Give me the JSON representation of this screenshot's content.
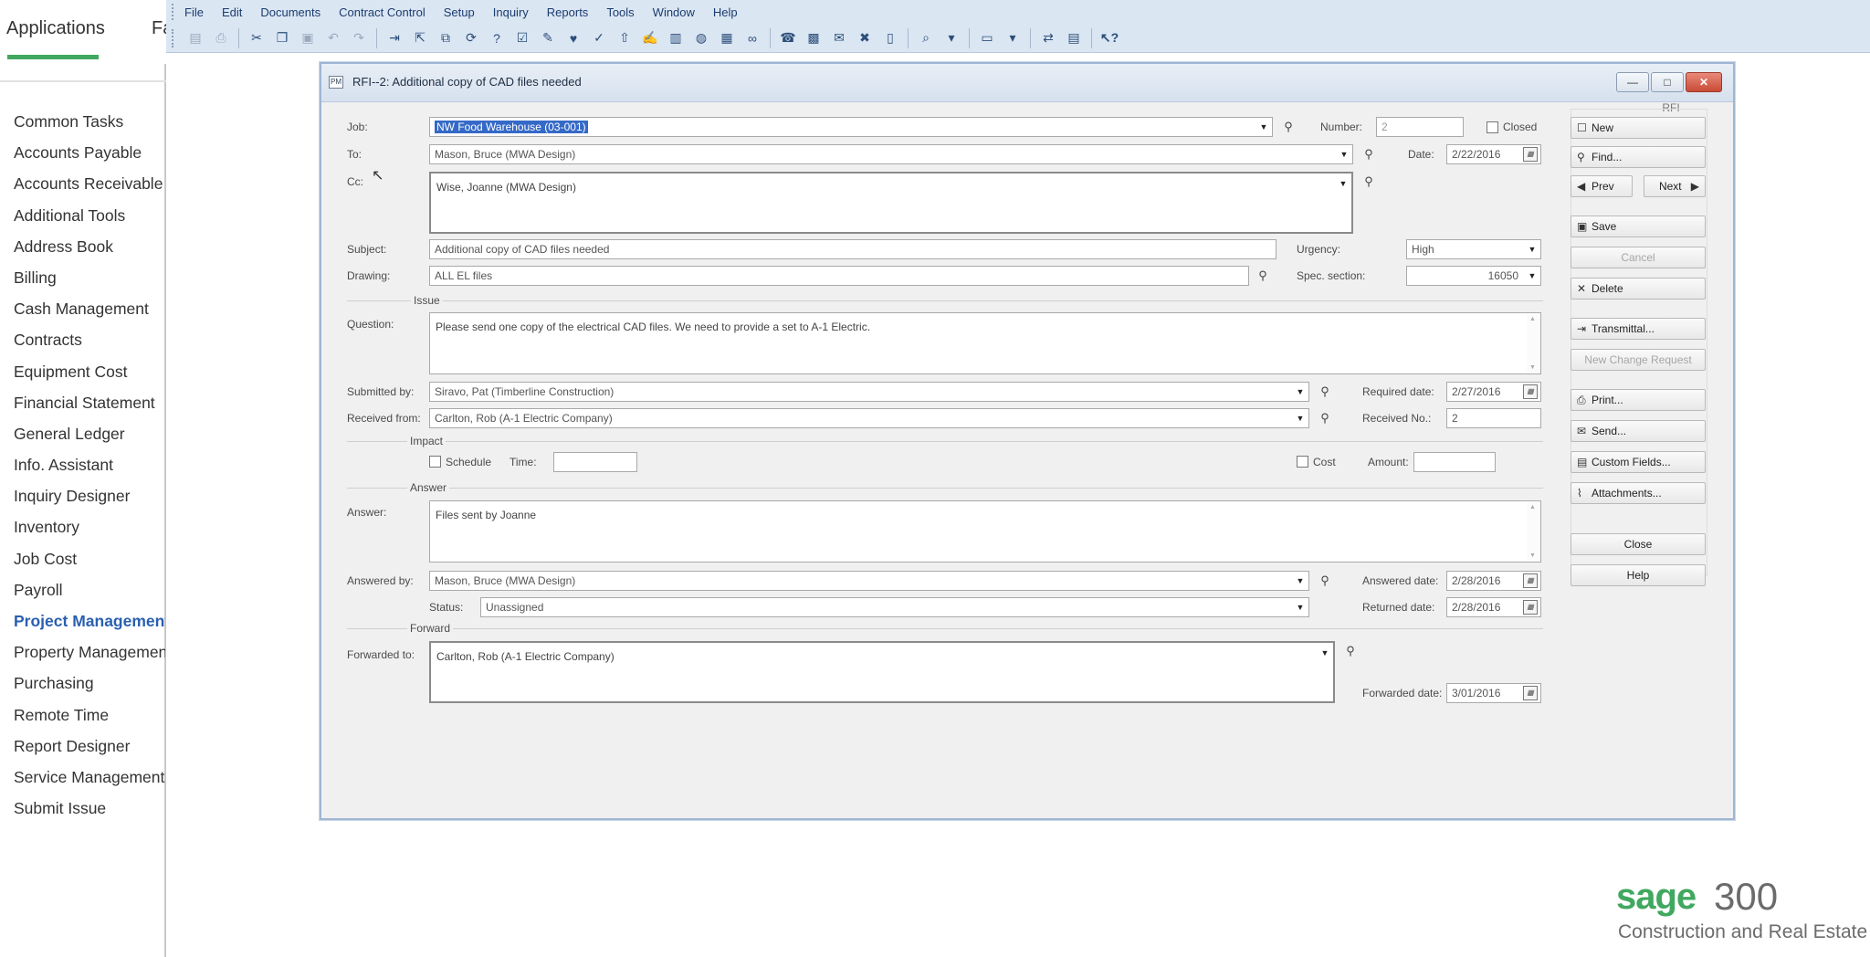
{
  "left_panel": {
    "active_tab": "Applications",
    "other_tab": "Fa",
    "items": [
      {
        "label": "Common Tasks"
      },
      {
        "label": "Accounts Payable"
      },
      {
        "label": "Accounts Receivable"
      },
      {
        "label": "Additional Tools"
      },
      {
        "label": "Address Book"
      },
      {
        "label": "Billing"
      },
      {
        "label": "Cash Management"
      },
      {
        "label": "Contracts"
      },
      {
        "label": "Equipment Cost"
      },
      {
        "label": "Financial Statement"
      },
      {
        "label": "General Ledger"
      },
      {
        "label": "Info. Assistant"
      },
      {
        "label": "Inquiry Designer"
      },
      {
        "label": "Inventory"
      },
      {
        "label": "Job Cost"
      },
      {
        "label": "Payroll"
      },
      {
        "label": "Project Management"
      },
      {
        "label": "Property Management"
      },
      {
        "label": "Purchasing"
      },
      {
        "label": "Remote Time"
      },
      {
        "label": "Report Designer"
      },
      {
        "label": "Service Management"
      },
      {
        "label": "Submit Issue"
      }
    ],
    "active_item": "Project Management"
  },
  "menu": [
    "File",
    "Edit",
    "Documents",
    "Contract Control",
    "Setup",
    "Inquiry",
    "Reports",
    "Tools",
    "Window",
    "Help"
  ],
  "dialog": {
    "icon_text": "PM",
    "title": "RFI--2: Additional copy of CAD files needed",
    "labels": {
      "job": "Job:",
      "number": "Number:",
      "closed": "Closed",
      "to": "To:",
      "date": "Date:",
      "cc": "Cc:",
      "subject": "Subject:",
      "urgency": "Urgency:",
      "drawing": "Drawing:",
      "spec_section": "Spec. section:",
      "issue": "Issue",
      "question": "Question:",
      "submitted_by": "Submitted by:",
      "required_date": "Required date:",
      "received_from": "Received from:",
      "received_no": "Received No.:",
      "impact": "Impact",
      "schedule": "Schedule",
      "time": "Time:",
      "cost": "Cost",
      "amount": "Amount:",
      "answer_section": "Answer",
      "answer": "Answer:",
      "answered_by": "Answered by:",
      "answered_date": "Answered date:",
      "status": "Status:",
      "returned_date": "Returned date:",
      "forward": "Forward",
      "forwarded_to": "Forwarded to:",
      "forwarded_date": "Forwarded date:"
    },
    "values": {
      "job": "NW Food Warehouse (03-001)",
      "number": "2",
      "to": "Mason, Bruce (MWA Design)",
      "date": "2/22/2016",
      "cc": "Wise, Joanne (MWA Design)",
      "subject": "Additional copy of CAD files needed",
      "urgency": "High",
      "drawing": "ALL EL files",
      "spec_section": "16050",
      "question": "Please send one copy of the electrical CAD files. We need to provide a set to A-1 Electric.",
      "submitted_by": "Siravo, Pat (Timberline Construction)",
      "required_date": "2/27/2016",
      "received_from": "Carlton, Rob (A-1 Electric Company)",
      "received_no": "2",
      "time": "",
      "amount": "",
      "answer": "Files sent by Joanne",
      "answered_by": "Mason, Bruce (MWA Design)",
      "answered_date": "2/28/2016",
      "status": "Unassigned",
      "returned_date": "2/28/2016",
      "forwarded_to": "Carlton, Rob (A-1 Electric Company)",
      "forwarded_date": "3/01/2016"
    },
    "buttons": {
      "group_caption": "RFI",
      "new": "New",
      "find": "Find...",
      "prev": "Prev",
      "next": "Next",
      "save": "Save",
      "cancel": "Cancel",
      "delete": "Delete",
      "transmittal": "Transmittal...",
      "new_change_request": "New Change Request",
      "print": "Print...",
      "send": "Send...",
      "custom_fields": "Custom Fields...",
      "attachments": "Attachments...",
      "close": "Close",
      "help": "Help"
    }
  },
  "brand": {
    "name": "sage",
    "product": "300",
    "tagline": "Construction and Real Estate",
    "color": "#41a85f"
  }
}
